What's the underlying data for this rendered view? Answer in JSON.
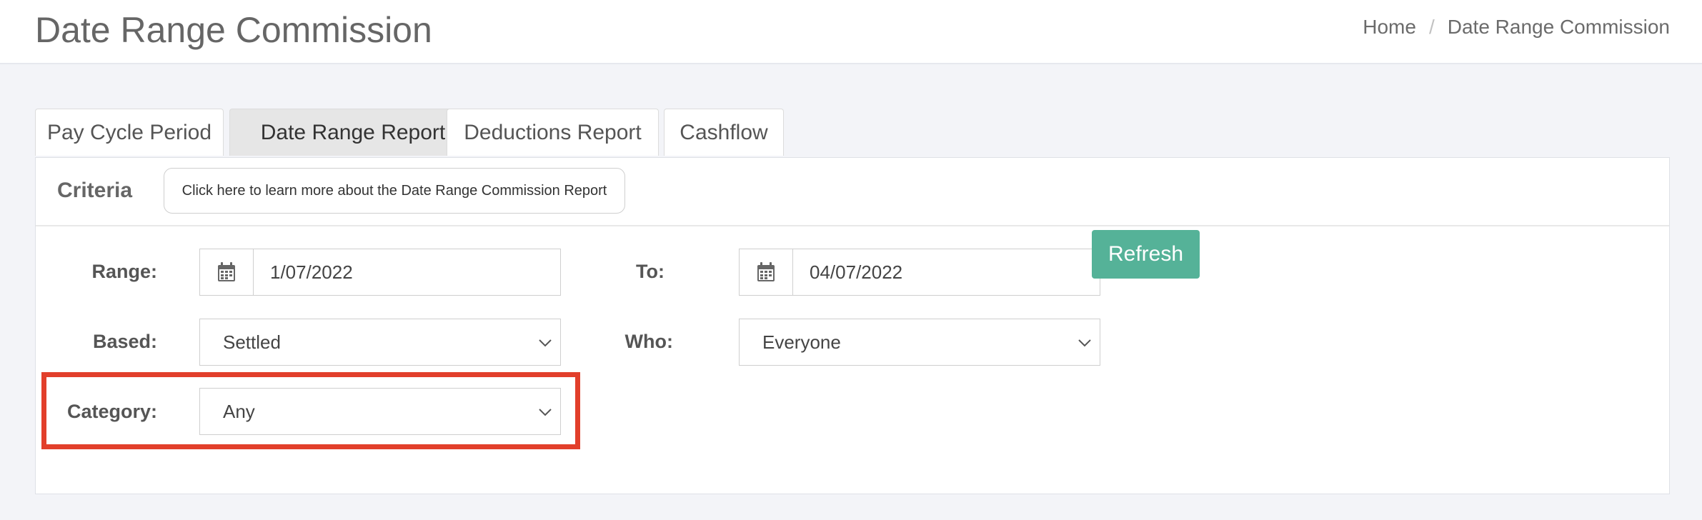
{
  "header": {
    "title": "Date Range Commission",
    "breadcrumb": {
      "home": "Home",
      "separator": "/",
      "current": "Date Range Commission"
    }
  },
  "tabs": [
    {
      "label": "Pay Cycle Period",
      "active": false
    },
    {
      "label": "Date Range Report",
      "active": true
    },
    {
      "label": "Deductions Report",
      "active": false
    },
    {
      "label": "Cashflow",
      "active": false
    }
  ],
  "criteria": {
    "title": "Criteria",
    "learn_more": "Click here to learn more about the Date Range Commission Report"
  },
  "form": {
    "range": {
      "label": "Range:",
      "value": "1/07/2022",
      "icon": "calendar-icon"
    },
    "to": {
      "label": "To:",
      "value": "04/07/2022",
      "icon": "calendar-icon"
    },
    "based": {
      "label": "Based:",
      "value": "Settled"
    },
    "who": {
      "label": "Who:",
      "value": "Everyone"
    },
    "category": {
      "label": "Category:",
      "value": "Any"
    },
    "refresh": "Refresh"
  },
  "colors": {
    "accent": "#55b298",
    "highlight": "#e23f2b"
  }
}
